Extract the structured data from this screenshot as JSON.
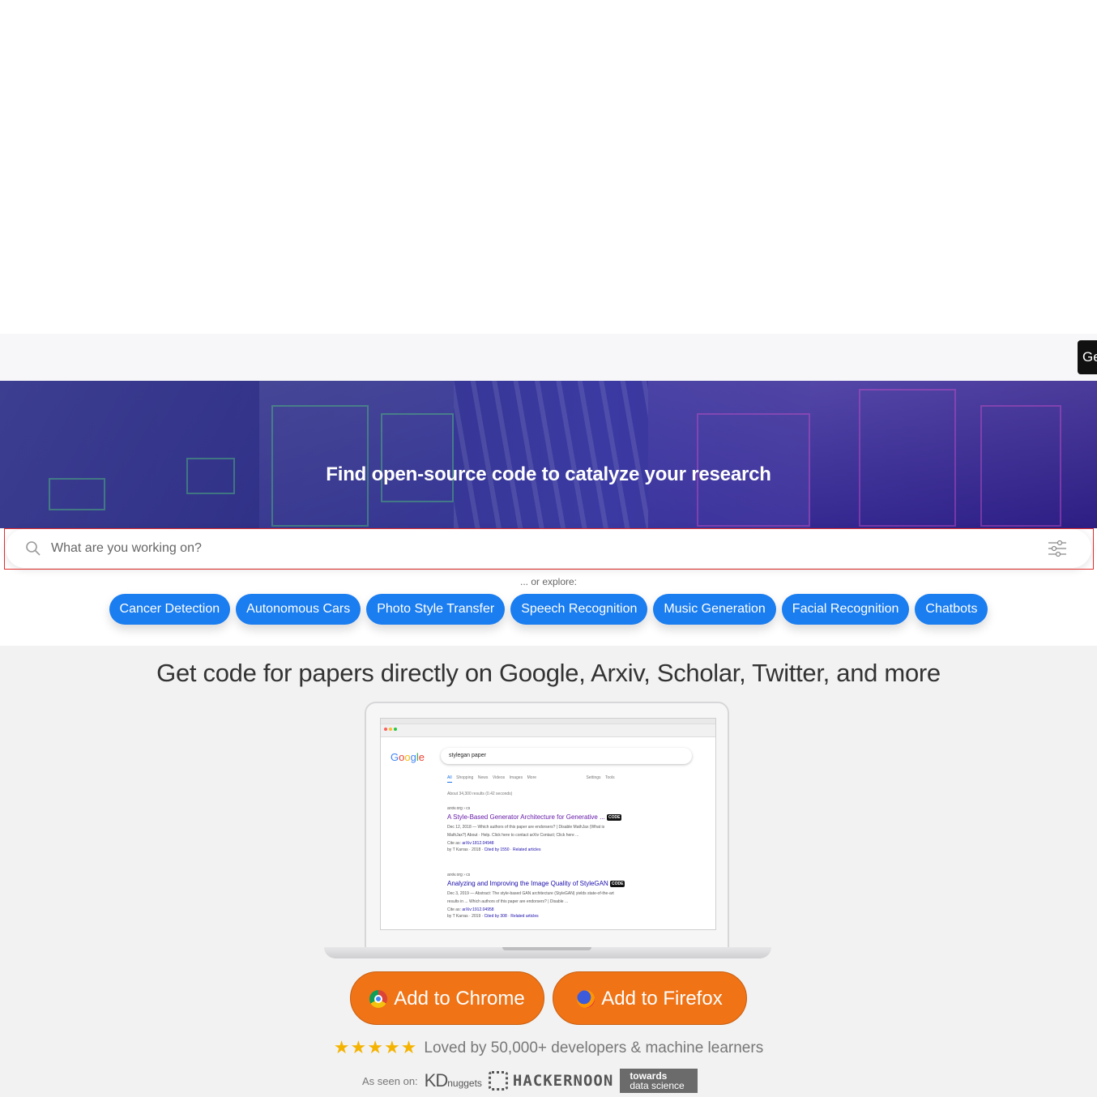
{
  "header": {
    "get_button_label": "Ge"
  },
  "hero": {
    "title": "Find open-source code to catalyze your research"
  },
  "search": {
    "placeholder": "What are you working on?",
    "icons": {
      "search": "search-icon",
      "filter": "filter-sliders-icon"
    }
  },
  "explore": {
    "label": "... or explore:",
    "topics": [
      "Cancer Detection",
      "Autonomous Cars",
      "Photo Style Transfer",
      "Speech Recognition",
      "Music Generation",
      "Facial Recognition",
      "Chatbots"
    ]
  },
  "promo": {
    "headline": "Get code for papers directly on Google, Arxiv, Scholar, Twitter, and more"
  },
  "screenshot": {
    "logo": "Google",
    "query": "stylegan paper",
    "tabs": [
      "All",
      "Shopping",
      "News",
      "Videos",
      "Images",
      "More",
      "Settings",
      "Tools"
    ],
    "stats": "About 34,300 results (0.42 seconds)",
    "results": [
      {
        "cite": "arxiv.org › cs",
        "title": "A Style-Based Generator Architecture for Generative ...",
        "badge": "CODE",
        "snippet1": "Dec 12, 2018 — Which authors of this paper are endorsers? | Disable MathJax (What is",
        "snippet2": "MathJax?) About · Help. Click here to contact arXiv Contact; Click here ...",
        "cite_as_label": "Cite as:",
        "cite_as_value": "arXiv:1812.04948",
        "meta_prefix": "by T Karras · 2018 ·",
        "cited_by": "Cited by 1550",
        "related": "Related articles"
      },
      {
        "cite": "arxiv.org › cs",
        "title": "Analyzing and Improving the Image Quality of StyleGAN",
        "badge": "CODE",
        "snippet1": "Dec 3, 2019 — Abstract: The style-based GAN architecture (StyleGAN) yields state-of-the-art",
        "snippet2": "results in ... Which authors of this paper are endorsers? | Disable ...",
        "cite_as_label": "Cite as:",
        "cite_as_value": "arXiv:1912.04958",
        "meta_prefix": "by T Karras · 2019 ·",
        "cited_by": "Cited by 308",
        "related": "Related articles"
      }
    ]
  },
  "cta": {
    "chrome_label": "Add to Chrome",
    "firefox_label": "Add to Firefox"
  },
  "rating": {
    "stars": "★★★★★",
    "text": "Loved by 50,000+ developers & machine learners"
  },
  "press": {
    "label": "As seen on:",
    "kd_big": "KD",
    "kd_small": "nuggets",
    "hackernoon": "HACKERNOON",
    "tds_line1": "towards",
    "tds_line2": "data science"
  }
}
